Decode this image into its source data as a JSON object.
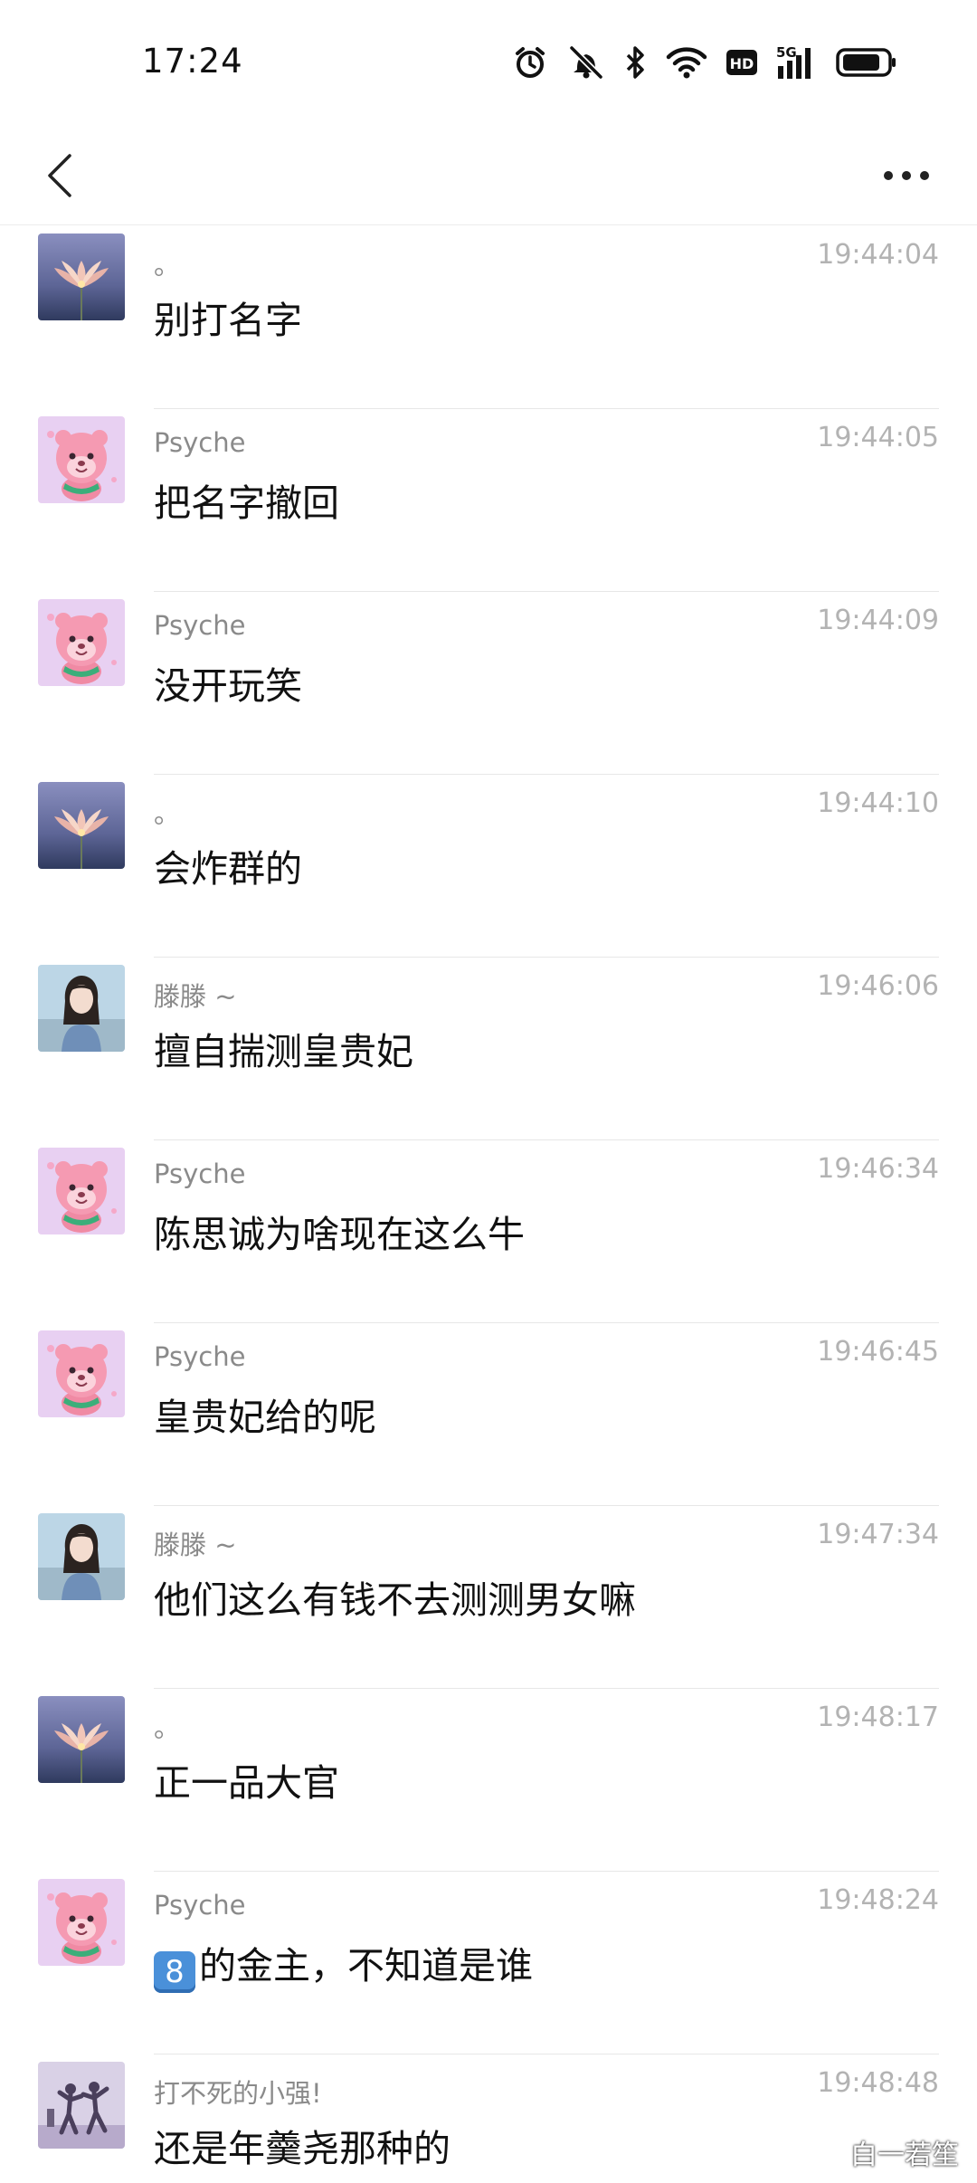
{
  "status_bar": {
    "time": "17:24",
    "icons": [
      "alarm-icon",
      "muted-bell-icon",
      "bluetooth-icon",
      "wifi-icon",
      "hd-icon",
      "signal-5g-icon",
      "battery-icon"
    ],
    "hd_label": "HD",
    "network_label": "5G"
  },
  "header": {
    "back_icon": "back-chevron-icon",
    "more_icon": "more-dots-icon"
  },
  "messages": [
    {
      "avatar": "lotus",
      "sender": "。",
      "time": "19:44:04",
      "text": "别打名字"
    },
    {
      "avatar": "pink-bear",
      "sender": "Psyche",
      "time": "19:44:05",
      "text": "把名字撤回"
    },
    {
      "avatar": "pink-bear",
      "sender": "Psyche",
      "time": "19:44:09",
      "text": "没开玩笑"
    },
    {
      "avatar": "lotus",
      "sender": "。",
      "time": "19:44:10",
      "text": "会炸群的"
    },
    {
      "avatar": "girl",
      "sender": "滕滕 ~",
      "time": "19:46:06",
      "text": "擅自揣测皇贵妃"
    },
    {
      "avatar": "pink-bear",
      "sender": "Psyche",
      "time": "19:46:34",
      "text": "陈思诚为啥现在这么牛"
    },
    {
      "avatar": "pink-bear",
      "sender": "Psyche",
      "time": "19:46:45",
      "text": "皇贵妃给的呢"
    },
    {
      "avatar": "girl",
      "sender": "滕滕 ~",
      "time": "19:47:34",
      "text": "他们这么有钱不去测测男女嘛"
    },
    {
      "avatar": "lotus",
      "sender": "。",
      "time": "19:48:17",
      "text": "正一品大官"
    },
    {
      "avatar": "pink-bear",
      "sender": "Psyche",
      "time": "19:48:24",
      "emoji": "8",
      "text": "的金主，不知道是谁"
    },
    {
      "avatar": "dancers",
      "sender": "打不死的小强!",
      "time": "19:48:48",
      "text": "还是年羹尧那种的"
    }
  ],
  "watermark": "白一若笙",
  "colors": {
    "background": "#ffffff",
    "sender_text": "#8a8a8a",
    "time_text": "#b3b3b3",
    "message_text": "#111111",
    "divider": "#e7e7e7",
    "keycap": "#4a90d9"
  }
}
